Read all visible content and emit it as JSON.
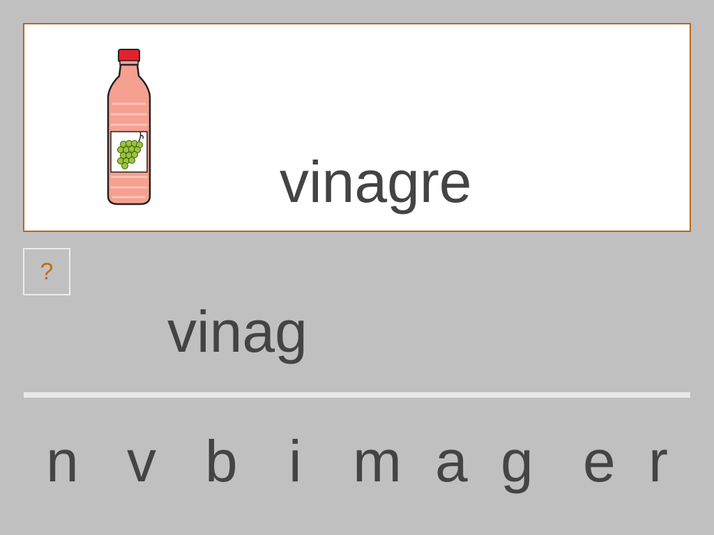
{
  "card": {
    "image_icon": "vinegar-bottle-icon",
    "word": "vinagre"
  },
  "help": {
    "label": "?"
  },
  "answer": {
    "text": "vinag"
  },
  "letters": [
    "n",
    "v",
    "b",
    "i",
    "m",
    "a",
    "g",
    "e",
    "r"
  ],
  "colors": {
    "background": "#c0c0c0",
    "card_border": "#b8681c",
    "text": "#444444",
    "help_mark": "#c66a12"
  }
}
